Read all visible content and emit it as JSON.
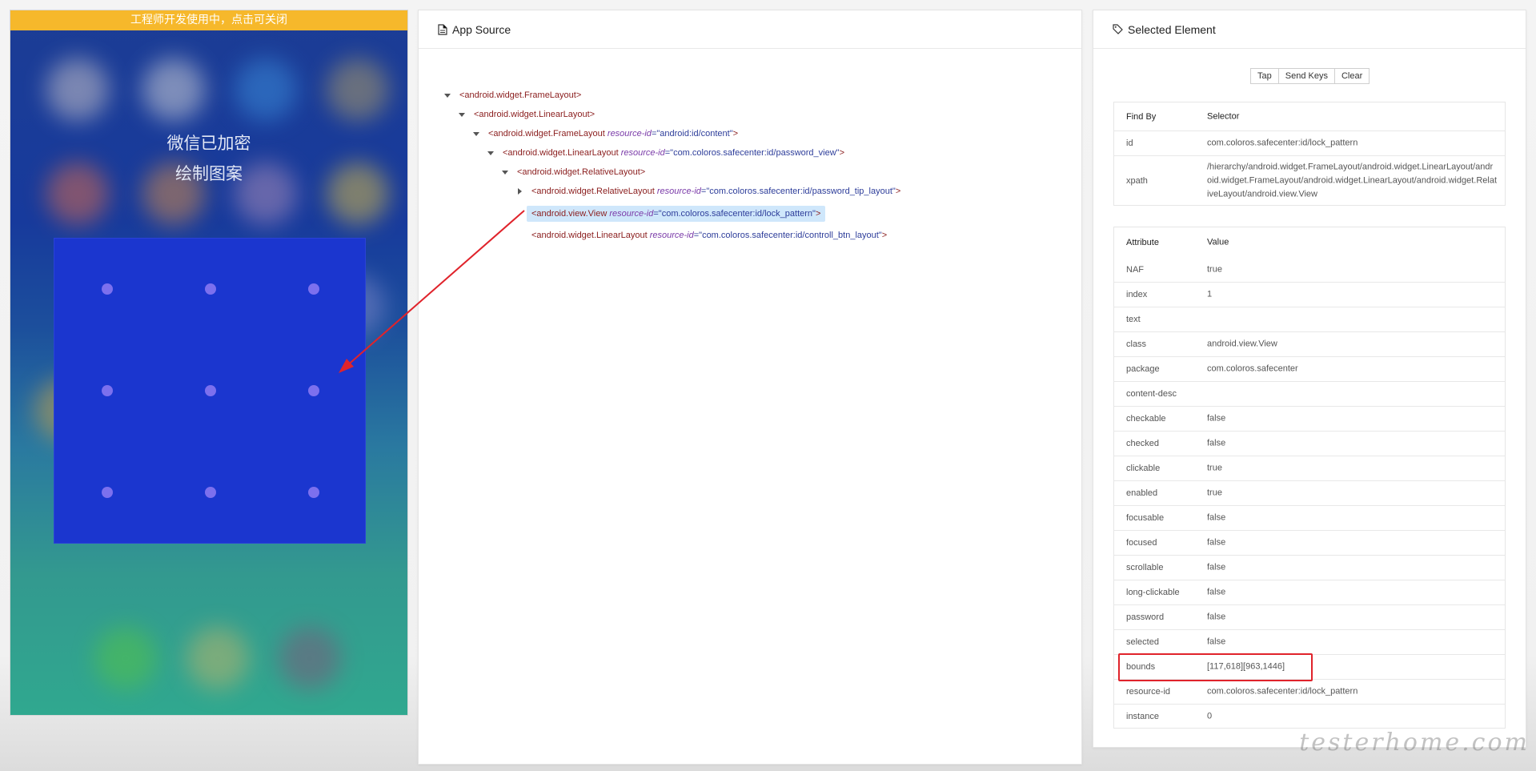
{
  "device": {
    "banner": "工程师开发使用中，点击可关闭",
    "title_line1": "微信已加密",
    "title_line2": "绘制图案"
  },
  "app_source": {
    "title": "App Source",
    "icon": "file-text-icon",
    "nodes": [
      {
        "tag": "<android.widget.FrameLayout>",
        "attr": "",
        "value": "",
        "close": ""
      },
      {
        "tag": "<android.widget.LinearLayout>",
        "attr": "",
        "value": "",
        "close": ""
      },
      {
        "tag": "<android.widget.FrameLayout ",
        "attr": "resource-id",
        "value": "=\"android:id/content\"",
        "close": ">"
      },
      {
        "tag": "<android.widget.LinearLayout ",
        "attr": "resource-id",
        "value": "=\"com.coloros.safecenter:id/password_view\"",
        "close": ">"
      },
      {
        "tag": "<android.widget.RelativeLayout>",
        "attr": "",
        "value": "",
        "close": ""
      },
      {
        "tag": "<android.widget.RelativeLayout ",
        "attr": "resource-id",
        "value": "=\"com.coloros.safecenter:id/password_tip_layout\"",
        "close": ">"
      },
      {
        "tag": "<android.view.View ",
        "attr": "resource-id",
        "value": "=\"com.coloros.safecenter:id/lock_pattern\"",
        "close": ">"
      },
      {
        "tag": "<android.widget.LinearLayout ",
        "attr": "resource-id",
        "value": "=\"com.coloros.safecenter:id/controll_btn_layout\"",
        "close": ">"
      }
    ]
  },
  "selected_element": {
    "title": "Selected Element",
    "icon": "tag-icon",
    "actions": {
      "tap": "Tap",
      "send_keys": "Send Keys",
      "clear": "Clear"
    },
    "selector_table": {
      "headers": [
        "Find By",
        "Selector"
      ],
      "rows": [
        [
          "id",
          "com.coloros.safecenter:id/lock_pattern"
        ],
        [
          "xpath",
          "/hierarchy/android.widget.FrameLayout/android.widget.LinearLayout/android.widget.FrameLayout/android.widget.LinearLayout/android.widget.RelativeLayout/android.view.View"
        ]
      ]
    },
    "attribute_table": {
      "headers": [
        "Attribute",
        "Value"
      ],
      "rows": [
        [
          "NAF",
          "true"
        ],
        [
          "index",
          "1"
        ],
        [
          "text",
          ""
        ],
        [
          "class",
          "android.view.View"
        ],
        [
          "package",
          "com.coloros.safecenter"
        ],
        [
          "content-desc",
          ""
        ],
        [
          "checkable",
          "false"
        ],
        [
          "checked",
          "false"
        ],
        [
          "clickable",
          "true"
        ],
        [
          "enabled",
          "true"
        ],
        [
          "focusable",
          "false"
        ],
        [
          "focused",
          "false"
        ],
        [
          "scrollable",
          "false"
        ],
        [
          "long-clickable",
          "false"
        ],
        [
          "password",
          "false"
        ],
        [
          "selected",
          "false"
        ],
        [
          "bounds",
          "[117,618][963,1446]"
        ],
        [
          "resource-id",
          "com.coloros.safecenter:id/lock_pattern"
        ],
        [
          "instance",
          "0"
        ]
      ]
    }
  },
  "watermark": "testerhome.com",
  "colors": {
    "banner": "#f6b82b",
    "annotation": "#e0232b",
    "selected_node": "#cfe7fb"
  }
}
